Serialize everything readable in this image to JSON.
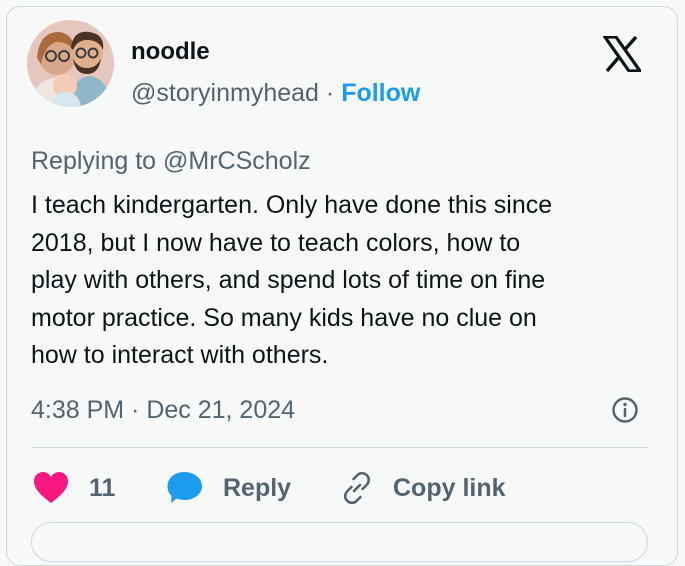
{
  "user": {
    "display_name": "noodle",
    "handle": "@storyinmyhead",
    "separator": "·",
    "follow_label": "Follow"
  },
  "tweet": {
    "replying_to": "Replying to @MrCScholz",
    "lines": [
      "I teach kindergarten. Only have done this since",
      "2018, but I now have to teach colors, how to",
      "play with others, and spend lots of time on fine",
      "motor practice. So many kids have no clue on",
      "how to interact with others."
    ],
    "timestamp": "4:38 PM · Dec 21, 2024"
  },
  "actions": {
    "like_count": "11",
    "reply_label": "Reply",
    "copy_link_label": "Copy link"
  },
  "colors": {
    "like": "#f91880",
    "reply": "#1d9bf0",
    "follow": "#1d9bf0",
    "secondary_text": "#536471"
  },
  "icons": {
    "brand": "x-logo-icon",
    "info": "info-icon",
    "like": "heart-icon",
    "reply": "speech-bubble-icon",
    "copy": "link-icon"
  }
}
